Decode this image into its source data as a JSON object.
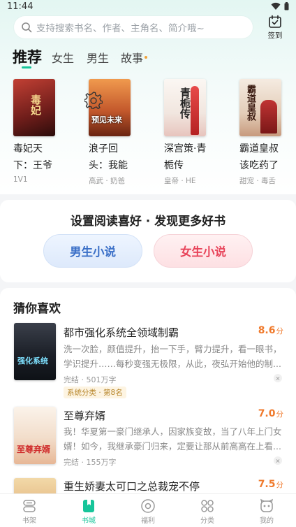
{
  "status_bar": {
    "time": "11:44"
  },
  "search": {
    "placeholder": "支持搜索书名、作者、主角名、简介哦~"
  },
  "signin": {
    "label": "签到"
  },
  "tabs": [
    {
      "label": "推荐",
      "active": true
    },
    {
      "label": "女生",
      "active": false
    },
    {
      "label": "男生",
      "active": false
    },
    {
      "label": "故事",
      "active": false
    }
  ],
  "featured_books": [
    {
      "title": "毒妃天下：王爷",
      "tag": "1V1",
      "cover_text": "毒妃",
      "cover_color": "#8a2a24"
    },
    {
      "title": "浪子回头：我能",
      "tag": "高武 · 奶爸",
      "cover_text": "预见未来",
      "cover_color": "#b8542a"
    },
    {
      "title": "深宫策·青栀传",
      "tag": "皇帝 · HE",
      "cover_text": "青栀传",
      "cover_color": "#f3eeea"
    },
    {
      "title": "霸道皇叔该吃药了",
      "tag": "甜宠 · 毒舌",
      "cover_text": "霸道皇叔",
      "cover_color": "#e9d8c6"
    }
  ],
  "preference": {
    "title": "设置阅读喜好 · 发现更多好书",
    "male_label": "男生小说",
    "female_label": "女生小说"
  },
  "recommendations": {
    "heading": "猜你喜欢",
    "items": [
      {
        "title": "都市强化系统全领域制霸",
        "score": "8.6",
        "score_unit": "分",
        "description": "洗一次脸，颜值提升，抬一下手，臂力提升，看一眼书，学识提升……每秒变强无极限，从此，夜弘开始他的制...",
        "meta": "完结 · 501万字",
        "badge": "系统分类 · 第8名",
        "cover_text": "强化系统"
      },
      {
        "title": "至尊弃婿",
        "score": "7.0",
        "score_unit": "分",
        "description": "我！华夏第一豪门继承人，因家族变故，当了八年上门女婿！如今，我继承豪门归来，定要让那从前高高在上看...",
        "meta": "完结 · 155万字",
        "badge": "",
        "cover_text": "至尊弃婿"
      },
      {
        "title": "重生娇妻太可口之总裁宠不停",
        "score": "7.5",
        "score_unit": "分",
        "description": "",
        "meta": "",
        "badge": "",
        "cover_text": ""
      }
    ]
  },
  "bottom_nav": [
    {
      "label": "书架",
      "icon": "bookshelf-icon",
      "active": false
    },
    {
      "label": "书城",
      "icon": "bookstore-icon",
      "active": true
    },
    {
      "label": "福利",
      "icon": "welfare-icon",
      "active": false
    },
    {
      "label": "分类",
      "icon": "category-icon",
      "active": false
    },
    {
      "label": "我的",
      "icon": "profile-icon",
      "active": false
    }
  ],
  "colors": {
    "accent": "#17c59a",
    "score": "#f07a2c",
    "male": "#3a6fc7",
    "female": "#e8445a"
  }
}
